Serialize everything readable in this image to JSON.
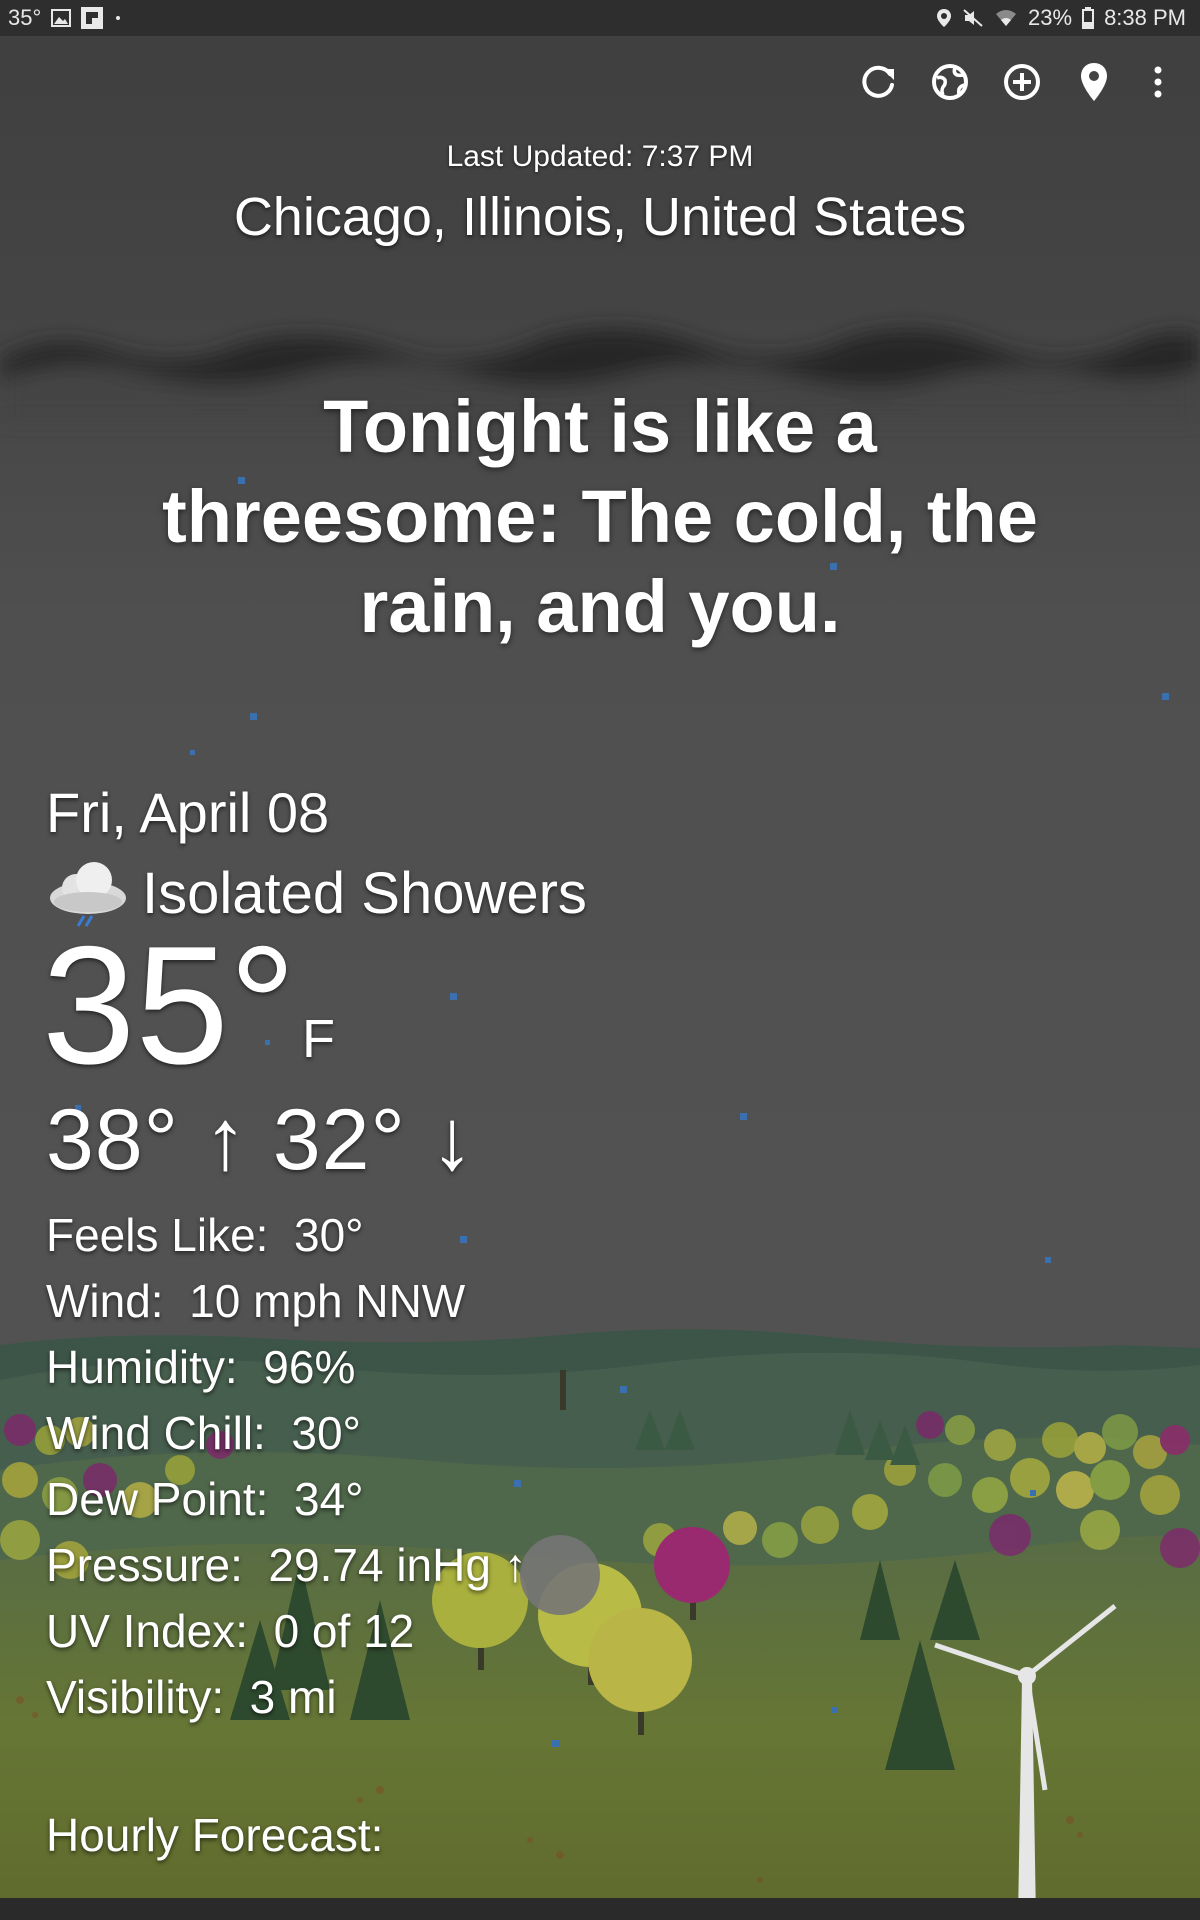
{
  "status_bar": {
    "left_temp": "35°",
    "battery": "23%",
    "time": "8:38 PM"
  },
  "toolbar": {
    "icons": [
      "refresh-icon",
      "globe-icon",
      "add-location-icon",
      "location-pin-icon",
      "more-vert-icon"
    ]
  },
  "header": {
    "last_updated": "Last Updated: 7:37 PM",
    "location": "Chicago, Illinois, United States"
  },
  "quote": {
    "line1": "Tonight is like a",
    "line2": "threesome: The cold, the",
    "line3": "rain, and you."
  },
  "current": {
    "date": "Fri, April 08",
    "condition": "Isolated Showers",
    "condition_icon": "cloud-rain-icon",
    "temperature": "35°",
    "unit": "F",
    "high_low": "38° ↑  32° ↓"
  },
  "stats": [
    {
      "label": "Feels Like:",
      "value": "30°"
    },
    {
      "label": "Wind:",
      "value": "10 mph NNW"
    },
    {
      "label": "Humidity:",
      "value": "96%"
    },
    {
      "label": "Wind Chill:",
      "value": "30°"
    },
    {
      "label": "Dew Point:",
      "value": "34°"
    },
    {
      "label": "Pressure:",
      "value": "29.74 inHg ↑"
    },
    {
      "label": "UV Index:",
      "value": "0 of 12"
    },
    {
      "label": "Visibility:",
      "value": "3 mi"
    }
  ],
  "hourly": {
    "title": "Hourly Forecast:"
  },
  "colors": {
    "status_bar": "#2e2e2e",
    "sky_top": "#3e3e3e",
    "cloud_band": "#2b2b2b",
    "sky": "#525252",
    "hills_far": "#3f5a4e",
    "hills_mid": "#4f6650",
    "meadow": "#6d7a3a",
    "rain": "#3a6fb0"
  }
}
